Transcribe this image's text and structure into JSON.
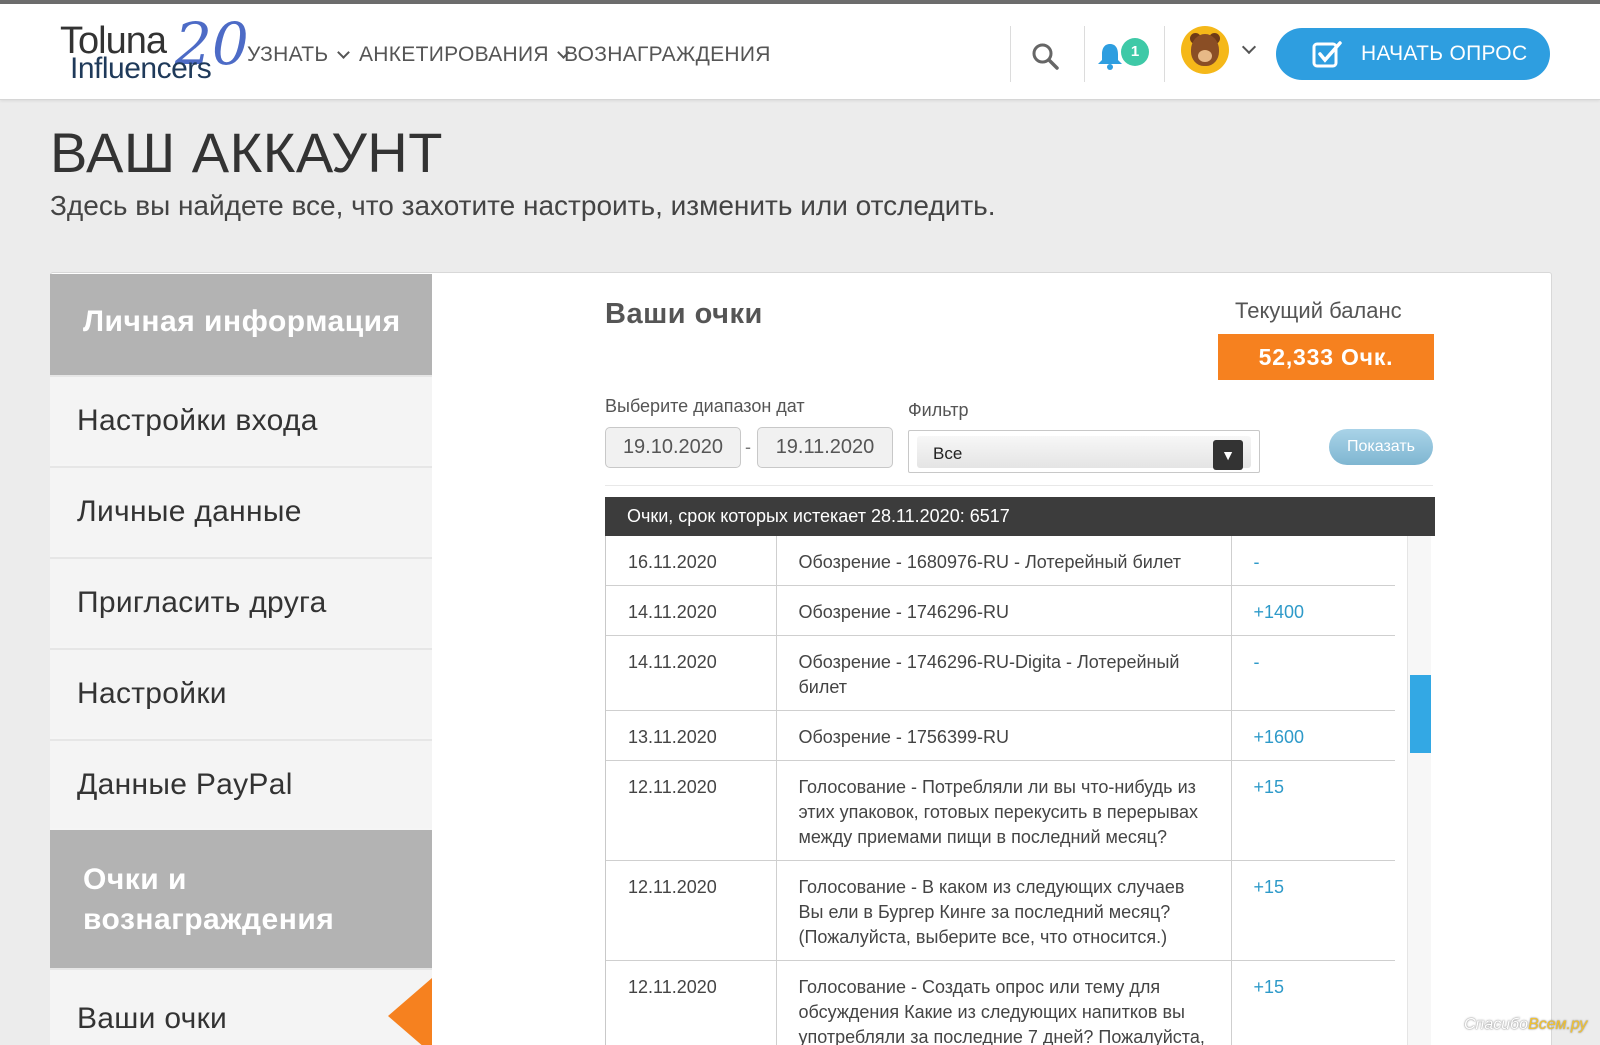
{
  "header": {
    "logo": {
      "line1": "Toluna",
      "line2": "Influencers",
      "badge": "20"
    },
    "nav": [
      {
        "label": "УЗНАТЬ",
        "has_dropdown": true
      },
      {
        "label": "АНКЕТИРОВАНИЯ",
        "has_dropdown": true
      },
      {
        "label": "ВОЗНАГРАЖДЕНИЯ",
        "has_dropdown": false
      }
    ],
    "icons": {
      "search": "search-icon",
      "notifications": "bell-icon",
      "avatar": "bear-avatar",
      "start": "checkbox-icon"
    },
    "notification_count": "1",
    "start_button": "НАЧАТЬ ОПРОС",
    "accent_color": "#2e9ee0"
  },
  "page": {
    "title": "ВАШ АККАУНТ",
    "subtitle": "Здесь вы найдете все, что захотите настроить, изменить или отследить."
  },
  "sidebar": {
    "section1": "Личная информация",
    "items1": [
      "Настройки входа",
      "Личные данные",
      "Пригласить друга",
      "Настройки",
      "Данные PayPal"
    ],
    "section2": "Очки и вознаграждения",
    "items2": [
      "Ваши очки"
    ],
    "active_item": "Ваши очки",
    "active_color": "#f6811f"
  },
  "points": {
    "title": "Ваши очки",
    "balance_label": "Текущий баланс",
    "balance_value": "52,333 Очк.",
    "balance_color": "#f6811f",
    "date_range_label": "Выберите диапазон дат",
    "date_from": "19.10.2020",
    "date_to": "19.11.2020",
    "filter_label": "Фильтр",
    "filter_value": "Все",
    "show_button": "Показать",
    "expiring_text": "Очки, срок которых истекает 28.11.2020: 6517",
    "rows": [
      {
        "date": "16.11.2020",
        "desc": "Обозрение - 1680976-RU - Лотерейный билет",
        "points": "-"
      },
      {
        "date": "14.11.2020",
        "desc": "Обозрение - 1746296-RU",
        "points": "+1400"
      },
      {
        "date": "14.11.2020",
        "desc": "Обозрение - 1746296-RU-Digita - Лотерейный билет",
        "points": "-"
      },
      {
        "date": "13.11.2020",
        "desc": "Обозрение - 1756399-RU",
        "points": "+1600"
      },
      {
        "date": "12.11.2020",
        "desc": "Голосование - Потребляли ли вы что-нибудь из этих упаковок, готовых перекусить в перерывах между приемами пищи в последний месяц?",
        "points": "+15"
      },
      {
        "date": "12.11.2020",
        "desc": "Голосование - В каком из следующих случаев Вы ели в Бургер Кинге за последний месяц? (Пожалуйста, выберите все, что относится.)",
        "points": "+15"
      },
      {
        "date": "12.11.2020",
        "desc": "Голосование - Создать опрос или тему для обсуждения Какие из следующих напитков вы употребляли за последние 7 дней? Пожалуйста,",
        "points": "+15"
      }
    ]
  },
  "watermark": {
    "part1": "Спасибо",
    "part2": "Всем.ру"
  }
}
